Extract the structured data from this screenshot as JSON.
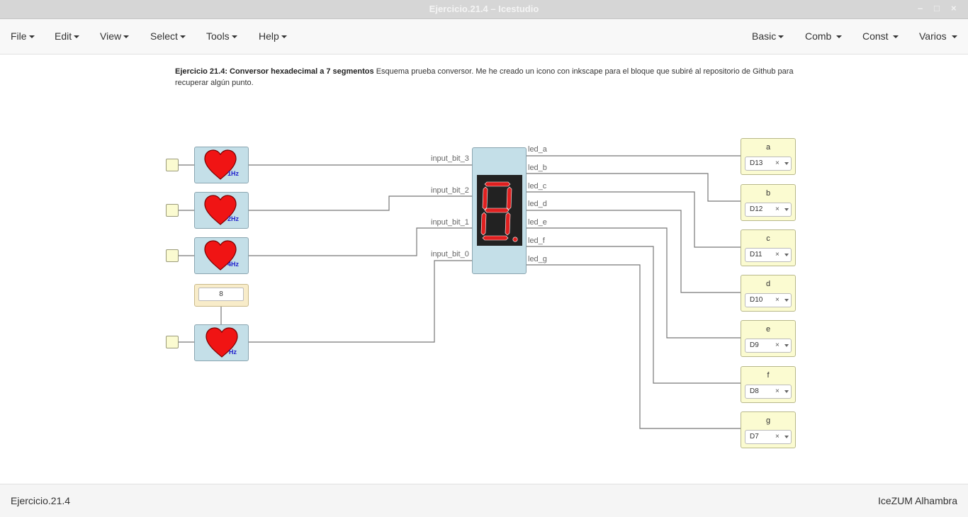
{
  "window": {
    "title": "Ejercicio.21.4 – Icestudio",
    "minimize": "–",
    "maximize": "□",
    "close": "×"
  },
  "menubar": {
    "left": [
      "File",
      "Edit",
      "View",
      "Select",
      "Tools",
      "Help"
    ],
    "right": [
      "Basic",
      "Comb",
      "Const",
      "Varios"
    ]
  },
  "description": {
    "bold": "Ejercicio 21.4: Conversor hexadecimal a 7 segmentos",
    "text": " Esquema prueba conversor. Me he creado un icono con inkscape para el bloque que subiré al repositorio de Github para recuperar algún punto."
  },
  "clock_blocks": [
    {
      "label": "1Hz",
      "icon": "heart-icon"
    },
    {
      "label": "2Hz",
      "icon": "heart-icon"
    },
    {
      "label": "4Hz",
      "icon": "heart-icon"
    },
    {
      "label": "Hz",
      "icon": "heart-icon"
    }
  ],
  "constant": {
    "value": "8"
  },
  "converter": {
    "inputs": [
      "input_bit_3",
      "input_bit_2",
      "input_bit_1",
      "input_bit_0"
    ],
    "outputs": [
      "led_a",
      "led_b",
      "led_c",
      "led_d",
      "led_e",
      "led_f",
      "led_g"
    ],
    "display_digit": "8",
    "segment_color": "#e02020",
    "display_bg": "#222222"
  },
  "outputs": [
    {
      "name": "a",
      "pin": "D13",
      "clear": "×"
    },
    {
      "name": "b",
      "pin": "D12",
      "clear": "×"
    },
    {
      "name": "c",
      "pin": "D11",
      "clear": "×"
    },
    {
      "name": "d",
      "pin": "D10",
      "clear": "×"
    },
    {
      "name": "e",
      "pin": "D9",
      "clear": "×"
    },
    {
      "name": "f",
      "pin": "D8",
      "clear": "×"
    },
    {
      "name": "g",
      "pin": "D7",
      "clear": "×"
    }
  ],
  "footer": {
    "project": "Ejercicio.21.4",
    "board": "IceZUM Alhambra"
  }
}
